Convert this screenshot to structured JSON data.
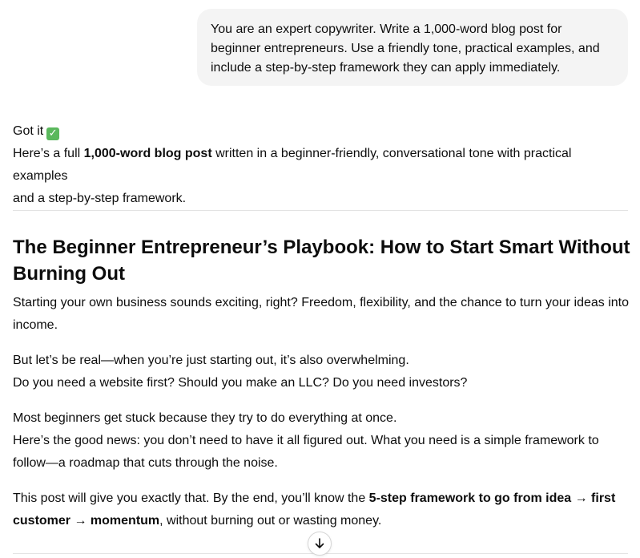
{
  "user_message": {
    "line1": "You are an expert copywriter. Write a 1,000-word blog post for",
    "line2": "beginner entrepreneurs. Use a friendly tone, practical examples, and",
    "line3": "include a step-by-step framework they can apply immediately."
  },
  "assistant": {
    "got_it": "Got it",
    "check_icon": "white-heavy-check-mark-icon",
    "intro_pre": "Here’s a full ",
    "intro_bold": "1,000-word blog post",
    "intro_post1": " written in a beginner-friendly, conversational tone with practical examples",
    "intro_post2": "and a step-by-step framework."
  },
  "article": {
    "title_line1": "The Beginner Entrepreneur’s Playbook: How to Start Smart Without",
    "title_line2": "Burning Out",
    "p1_line1": "Starting your own business sounds exciting, right? Freedom, flexibility, and the chance to turn your ideas into",
    "p1_line2": "income.",
    "p2_line1": "But let’s be real—when you’re just starting out, it’s also overwhelming.",
    "p2_line2": "Do you need a website first? Should you make an LLC? Do you need investors?",
    "p3_line1": "Most beginners get stuck because they try to do everything at once.",
    "p3_line2": "Here’s the good news: you don’t need to have it all figured out. What you need is a simple framework to",
    "p3_line3": "follow—a roadmap that cuts through the noise.",
    "p4_pre": "This post will give you exactly that. By the end, you’ll know the ",
    "p4_bold1": "5-step framework to go from idea → first",
    "p4_bold2": "customer → momentum",
    "p4_post": ", without burning out or wasting money."
  },
  "scroll_button": {
    "icon": "arrow-down-icon"
  }
}
